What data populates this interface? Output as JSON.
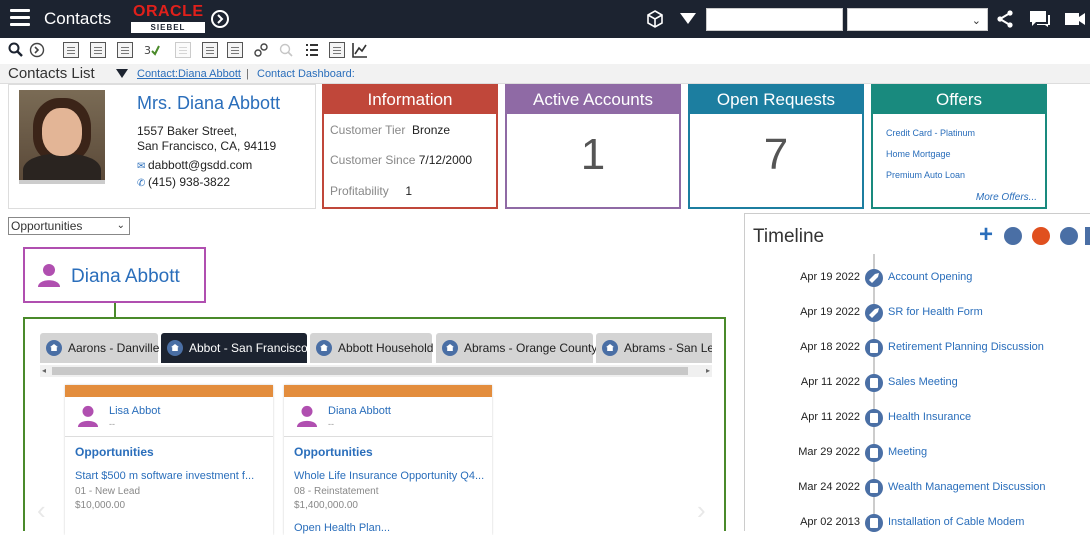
{
  "topbar": {
    "app_title": "Contacts",
    "logo_oracle": "ORACLE",
    "logo_siebel": "SIEBEL",
    "search_value": "",
    "select_value": ""
  },
  "breadcrumb": {
    "list_title": "Contacts List",
    "crumb1": "Contact:Diana Abbott",
    "separator": "|",
    "crumb2": "Contact Dashboard:"
  },
  "profile": {
    "name": "Mrs. Diana Abbott",
    "address1": "1557 Baker Street,",
    "address2": "San Francisco, CA, 94119",
    "email": "dabbott@gsdd.com",
    "phone": "(415) 938-3822"
  },
  "information": {
    "title": "Information",
    "tier_label": "Customer Tier",
    "tier_value": "Bronze",
    "since_label": "Customer Since",
    "since_value": "7/12/2000",
    "profit_label": "Profitability",
    "profit_value": "1"
  },
  "accounts": {
    "title": "Active Accounts",
    "count": "1"
  },
  "requests": {
    "title": "Open Requests",
    "count": "7"
  },
  "offers": {
    "title": "Offers",
    "items": [
      "Credit Card - Platinum",
      "Home Mortgage",
      "Premium Auto Loan"
    ],
    "more": "More Offers..."
  },
  "opportunities_select": "Opportunities",
  "contact_box_name": "Diana Abbott",
  "household_tabs": [
    "Aarons - Danville",
    "Abbot - San Francisco",
    "Abbott Household",
    "Abrams - Orange County",
    "Abrams - San Leandro"
  ],
  "cards": [
    {
      "name": "Lisa Abbot",
      "dash": "--",
      "section": "Opportunities",
      "opp": "Start $500 m software investment f...",
      "stage": "01 - New Lead",
      "amount": "$10,000.00",
      "next": ""
    },
    {
      "name": "Diana Abbott",
      "dash": "--",
      "section": "Opportunities",
      "opp": "Whole Life Insurance Opportunity Q4...",
      "stage": "08 - Reinstatement",
      "amount": "$1,400,000.00",
      "next": "Open Health Plan..."
    }
  ],
  "timeline": {
    "title": "Timeline",
    "events": [
      {
        "date": "Apr 19 2022",
        "label": "Account Opening",
        "icon": "tools-icon"
      },
      {
        "date": "Apr 19 2022",
        "label": "SR for Health Form",
        "icon": "tools-icon"
      },
      {
        "date": "Apr 18 2022",
        "label": "Retirement Planning Discussion",
        "icon": "document-icon"
      },
      {
        "date": "Apr 11 2022",
        "label": "Sales Meeting",
        "icon": "document-icon"
      },
      {
        "date": "Apr 11 2022",
        "label": "Health Insurance",
        "icon": "document-icon"
      },
      {
        "date": "Mar 29 2022",
        "label": "Meeting",
        "icon": "document-icon"
      },
      {
        "date": "Mar 24 2022",
        "label": "Wealth Management Discussion",
        "icon": "document-icon"
      },
      {
        "date": "Apr 02 2013",
        "label": "Installation of Cable Modem",
        "icon": "document-icon"
      }
    ]
  },
  "colors": {
    "topbar": "#1c2330",
    "information": "#c0473a",
    "accounts": "#8f6aa5",
    "requests": "#1c7ea0",
    "offers": "#198a7e",
    "link": "#2a6ebb",
    "contact_box": "#b04fb0",
    "household_border": "#4a8a2a",
    "card_bar": "#e38d3d"
  }
}
